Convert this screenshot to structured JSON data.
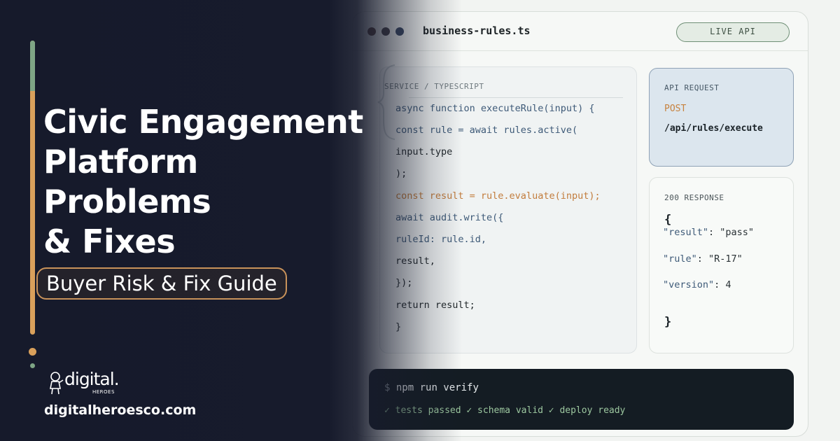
{
  "hero": {
    "title_lines": [
      "Civic Engagement",
      "Platform",
      "Problems",
      "& Fixes"
    ],
    "subtitle": "Buyer Risk & Fix Guide",
    "logo_word": "digital.",
    "logo_sub": "HEROES",
    "website": "digitalheroesco.com"
  },
  "window": {
    "filename": "business-rules.ts",
    "badge": "LIVE API"
  },
  "code": {
    "label": "SERVICE / TYPESCRIPT",
    "lines": [
      "async function executeRule(input) {",
      "const rule = await rules.active(",
      "input.type",
      ");",
      "const result = rule.evaluate(input);",
      "await audit.write({",
      "ruleId: rule.id,",
      "result,",
      "});",
      "return result;",
      "}"
    ]
  },
  "request": {
    "label": "API REQUEST",
    "method": "POST",
    "path": "/api/rules/execute"
  },
  "response": {
    "label": "200 RESPONSE",
    "open_brace": "{",
    "close_brace": "}",
    "fields": [
      {
        "key": "\"result\"",
        "sep": ": ",
        "value": "\"pass\""
      },
      {
        "key": "\"rule\"",
        "sep": ": ",
        "value": "\"R-17\""
      },
      {
        "key": "\"version\"",
        "sep": ": ",
        "value": "4"
      }
    ]
  },
  "terminal": {
    "prompt": "$",
    "command": "npm run verify",
    "output": "✓ tests passed ✓ schema valid ✓ deploy ready"
  },
  "colors": {
    "accent_orange": "#d9a05b",
    "accent_green": "#7ea585",
    "hero_bg": "#171b2c",
    "method_orange": "#c7823f"
  }
}
